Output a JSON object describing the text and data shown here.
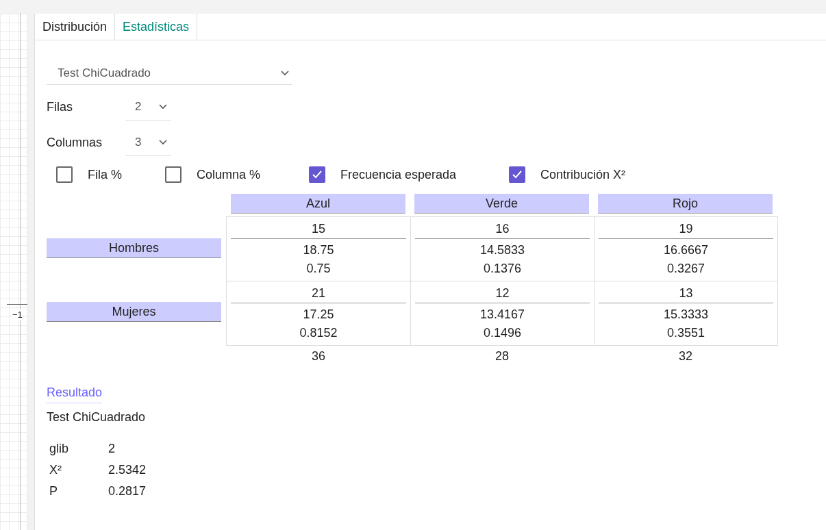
{
  "graph": {
    "axis_label": "−1"
  },
  "tabs": [
    {
      "label": "Distribución",
      "selected": false
    },
    {
      "label": "Estadísticas",
      "selected": true
    }
  ],
  "test_select": {
    "value": "Test ChiCuadrado"
  },
  "rows_select": {
    "label": "Filas",
    "value": "2"
  },
  "columns_select": {
    "label": "Columnas",
    "value": "3"
  },
  "options": [
    {
      "label": "Fila %",
      "checked": false
    },
    {
      "label": "Columna %",
      "checked": false
    },
    {
      "label": "Frecuencia esperada",
      "checked": true
    },
    {
      "label": "Contribución X²",
      "checked": true
    }
  ],
  "table": {
    "columns": [
      "Azul",
      "Verde",
      "Rojo"
    ],
    "rows": [
      {
        "label": "Hombres",
        "cells": [
          {
            "observed": "15",
            "expected": "18.75",
            "contribution": "0.75"
          },
          {
            "observed": "16",
            "expected": "14.5833",
            "contribution": "0.1376"
          },
          {
            "observed": "19",
            "expected": "16.6667",
            "contribution": "0.3267"
          }
        ]
      },
      {
        "label": "Mujeres",
        "cells": [
          {
            "observed": "21",
            "expected": "17.25",
            "contribution": "0.8152"
          },
          {
            "observed": "12",
            "expected": "13.4167",
            "contribution": "0.1496"
          },
          {
            "observed": "13",
            "expected": "15.3333",
            "contribution": "0.3551"
          }
        ]
      }
    ],
    "totals": [
      "36",
      "28",
      "32"
    ]
  },
  "result": {
    "heading": "Resultado",
    "title": "Test ChiCuadrado",
    "stats": [
      {
        "label": "glib",
        "value": "2"
      },
      {
        "label": "X²",
        "value": "2.5342"
      },
      {
        "label": "P",
        "value": "0.2817"
      }
    ]
  }
}
